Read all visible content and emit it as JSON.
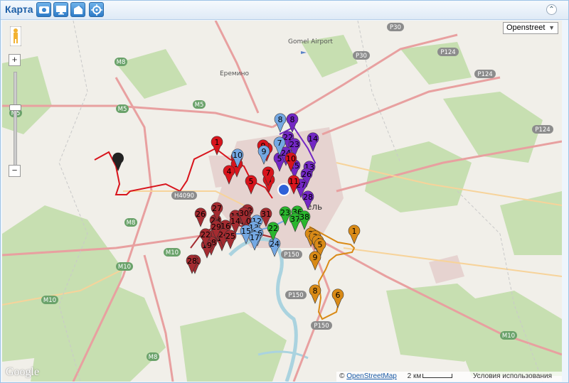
{
  "window": {
    "title": "Карта"
  },
  "toolbar": [
    {
      "name": "photo-button",
      "icon": "photo-icon"
    },
    {
      "name": "monitor-button",
      "icon": "monitor-icon"
    },
    {
      "name": "house-button",
      "icon": "house-icon"
    },
    {
      "name": "locate-button",
      "icon": "target-icon"
    }
  ],
  "collapse_symbol": "⌃",
  "map": {
    "map_type": "Openstreet",
    "map_type_arrow": "▼",
    "zoom_in": "+",
    "zoom_out": "−",
    "google_logo": "Google",
    "attribution": {
      "copy": "© ",
      "link": "OpenStreetMap",
      "scale": "2 км",
      "terms": "Условия использования"
    },
    "places": [
      "Gomel Airport",
      "Еремино",
      "ель"
    ],
    "roads": [
      "M5",
      "M5",
      "M5",
      "M8",
      "M8",
      "M8",
      "M10",
      "M10",
      "M10",
      "M10",
      "P30",
      "P30",
      "P124",
      "P124",
      "P124",
      "P150",
      "P150",
      "P150",
      "H4090"
    ]
  },
  "colors": {
    "red": "#d8141c",
    "darkred": "#a42b30",
    "orange": "#d98a16",
    "purple": "#7327c4",
    "green": "#2ab62e",
    "blue": "#74a8e3",
    "black": "#222222"
  },
  "markers": {
    "orange": [
      "1",
      "2",
      "3",
      "4",
      "5",
      "6",
      "8",
      "9"
    ],
    "red": [
      "1",
      "2",
      "3",
      "4",
      "5",
      "6",
      "7",
      "8",
      "9",
      "10",
      "11"
    ],
    "darkred": [
      "11",
      "12",
      "14",
      "15",
      "16",
      "17",
      "18",
      "19",
      "20",
      "21",
      "22",
      "23",
      "24",
      "25",
      "26",
      "27",
      "28",
      "29",
      "30",
      "31"
    ],
    "blue": [
      "7",
      "8",
      "9",
      "10",
      "12",
      "13",
      "15",
      "16",
      "17",
      "24"
    ],
    "purple": [
      "5",
      "8",
      "13",
      "14",
      "22",
      "23",
      "24",
      "25",
      "26",
      "27",
      "28"
    ],
    "green": [
      "22",
      "23",
      "36",
      "37",
      "38"
    ]
  }
}
